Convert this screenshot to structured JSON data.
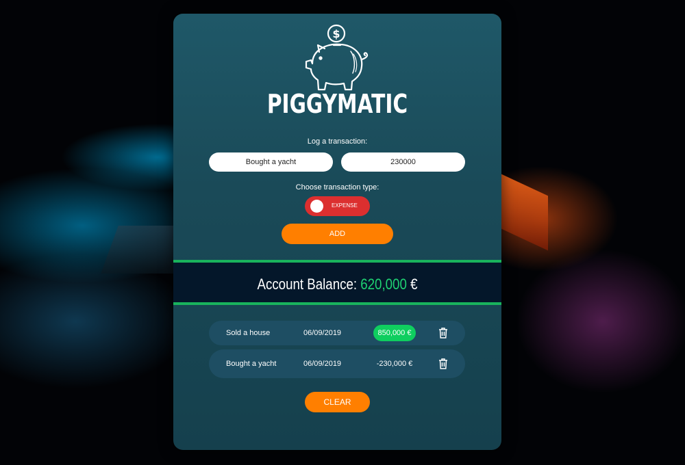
{
  "app": {
    "title": "PIGGYMATIC"
  },
  "form": {
    "log_label": "Log a transaction:",
    "description_value": "Bought a yacht",
    "amount_value": "230000",
    "type_label": "Choose transaction type:",
    "toggle_label": "EXPENSE",
    "add_label": "ADD"
  },
  "balance": {
    "label": "Account Balance:",
    "amount": "620,000",
    "currency": "€"
  },
  "transactions": [
    {
      "description": "Sold a house",
      "date": "06/09/2019",
      "amount": "850,000 €",
      "type": "income"
    },
    {
      "description": "Bought a yacht",
      "date": "06/09/2019",
      "amount": "-230,000 €",
      "type": "expense"
    }
  ],
  "actions": {
    "clear_label": "CLEAR"
  },
  "icons": {
    "logo": "piggy-bank-icon",
    "delete": "trash-icon"
  },
  "colors": {
    "accent": "#ff7f00",
    "income": "#0fce5f",
    "expense_toggle": "#dc2f2f",
    "balance_positive": "#1fd273",
    "divider": "#19b35c"
  }
}
